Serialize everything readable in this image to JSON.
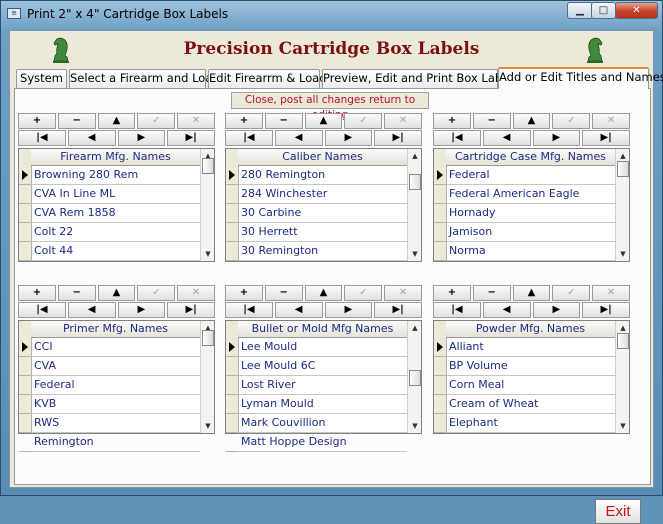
{
  "window": {
    "title": "Print 2\" x 4\" Cartridge Box Labels",
    "app_icon": "form-icon"
  },
  "app_title": "Precision Cartridge Box Labels",
  "tabs": [
    {
      "label": "System",
      "active": false
    },
    {
      "label": "Select a Firearm and Load",
      "active": false
    },
    {
      "label": "Edit Firearrm & Load",
      "active": false
    },
    {
      "label": "Preview, Edit and Print Box Labels",
      "active": false
    },
    {
      "label": "Add or Edit Titles and Names",
      "active": true
    }
  ],
  "close_post_label": "Close, post all changes return to editing",
  "toolbar": {
    "add": "+",
    "delete": "−",
    "up": "▲",
    "post": "✓",
    "cancel": "✕",
    "first": "|◀",
    "prev": "◀",
    "next": "▶",
    "last": "▶|"
  },
  "lists": [
    {
      "header": "Firearm Mfg. Names",
      "rows": [
        "Browning 280 Rem",
        "CVA In Line ML",
        "CVA Rem 1858",
        "Colt 22",
        "Colt 44"
      ],
      "current_row": 0
    },
    {
      "header": "Caliber Names",
      "rows": [
        "280 Remington",
        "284 Winchester",
        "30 Carbine",
        "30 Herrett",
        "30 Remington"
      ],
      "current_row": 0
    },
    {
      "header": "Cartridge Case Mfg. Names",
      "rows": [
        "Federal",
        "Federal American Eagle",
        "Hornady",
        "Jamison",
        "Norma"
      ],
      "current_row": 0
    },
    {
      "header": "Primer Mfg. Names",
      "rows": [
        "CCI",
        "CVA",
        "Federal",
        "KVB",
        "RWS",
        "Remington"
      ],
      "current_row": 0
    },
    {
      "header": "Bullet or Mold Mfg Names",
      "rows": [
        "Lee Mould",
        "Lee Mould 6C",
        "Lost River",
        "Lyman Mould",
        "Mark Couvillion",
        "Matt Hoppe Design"
      ],
      "current_row": 0
    },
    {
      "header": "Powder Mfg. Names",
      "rows": [
        "Alliant",
        "BP Volume",
        "Corn Meal",
        "Cream of Wheat",
        "Elephant"
      ],
      "current_row": 0
    }
  ],
  "exit_label": "Exit"
}
